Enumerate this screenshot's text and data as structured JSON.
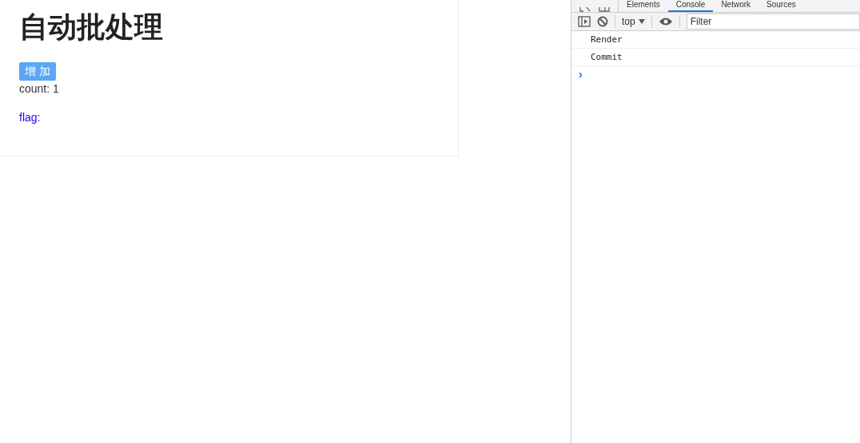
{
  "page": {
    "title": "自动批处理",
    "button": "增 加",
    "count_text": "count: 1",
    "flag_text": "flag:"
  },
  "devtools": {
    "tabs": [
      {
        "label": "Elements",
        "selected": false
      },
      {
        "label": "Console",
        "selected": true
      },
      {
        "label": "Network",
        "selected": false
      },
      {
        "label": "Sources",
        "selected": false
      }
    ],
    "context": "top",
    "filter": {
      "placeholder": "Filter"
    },
    "messages": [
      "Render",
      "Commit"
    ],
    "prompt": "›"
  }
}
